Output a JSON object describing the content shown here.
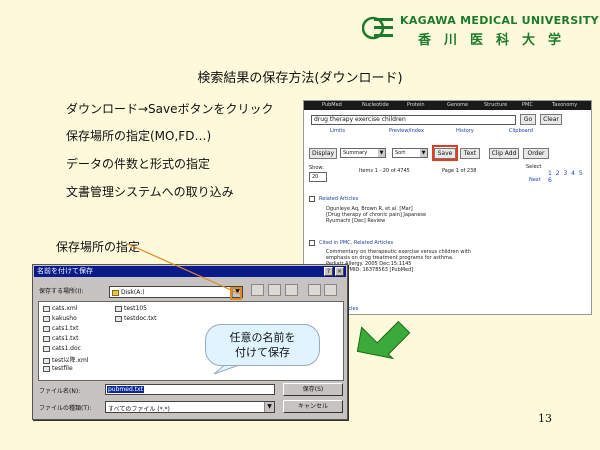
{
  "header": {
    "university_en": "KAGAWA MEDICAL UNIVERSITY",
    "university_jp": "香川医科大学",
    "accent_color": "#1d7a2c"
  },
  "slide": {
    "title": "検索結果の保存方法(ダウンロード)",
    "bullets": [
      "ダウンロード→Saveボタンをクリック",
      "保存場所の指定(MO,FD…)",
      "データの件数と形式の指定",
      "文書管理システムへの取り込み"
    ],
    "callout_label": "保存場所の指定",
    "page_number": "13"
  },
  "browser": {
    "nav_items": [
      "PubMed",
      "Nucleotide",
      "Protein",
      "Genome",
      "Structure",
      "PMC",
      "Taxonomy"
    ],
    "search_value": "drug therapy exercise children",
    "go_label": "Go",
    "clear_label": "Clear",
    "links": [
      "Limits",
      "Preview/Index",
      "History",
      "Clipboard"
    ],
    "display_label": "Display",
    "display_select": "Summary",
    "sort_select": "Sort",
    "save_label": "Save",
    "text_label": "Text",
    "clip_add_label": "Clip Add",
    "order_label": "Order",
    "show_label": "Show:",
    "show_value": "20",
    "items_text": "Items 1 - 20 of 4745",
    "page_text": "Page 1 of 238",
    "select_text": "Select",
    "pages": "1 2 3 4 5 6",
    "next_label": "Next",
    "results": [
      {
        "link": "Related Articles",
        "lines": [
          "Ogunleye Aq, Brown R, et al. [Mar]",
          "[Drug therapy of chronic pain] Japanese",
          "Ryumachi [Dec] Review"
        ]
      },
      {
        "link": "Cited in PMC, Related Articles",
        "lines": [
          "Commentary on therapeutic exercise versus children with",
          "emphasis on drug treatment programs for asthma.",
          "Pediatr Allergy. 2005 Dec;15:1145",
          "Review. PMID: 16378563 [PubMed]"
        ]
      },
      {
        "link": "Related Articles",
        "lines": []
      }
    ]
  },
  "dialog": {
    "title": "名前を付けて保存",
    "help_button": "?",
    "close_button": "×",
    "save_in_label": "保存する場所(I):",
    "save_in_value": "Disk(A:)",
    "files_col1": [
      "cats.xml",
      "kakusho",
      "cats1.txt",
      "cats1.txt",
      "cats1.doc",
      "test以降.xml",
      "testfile"
    ],
    "files_col2": [
      "test105",
      "testdoc.txt"
    ],
    "filename_label": "ファイル名(N):",
    "filename_value": "pubmed.txt",
    "filetype_label": "ファイルの種類(T):",
    "filetype_value": "すべてのファイル (*.*)",
    "save_button": "保存(S)",
    "cancel_button": "キャンセル"
  },
  "bubble": {
    "line1": "任意の名前を",
    "line2": "付けて保存"
  },
  "colors": {
    "background": "#fdfadb",
    "highlight_red": "#e23b1e",
    "arrow_green": "#2a9a2a",
    "dialog_title": "#0a1a8a"
  }
}
